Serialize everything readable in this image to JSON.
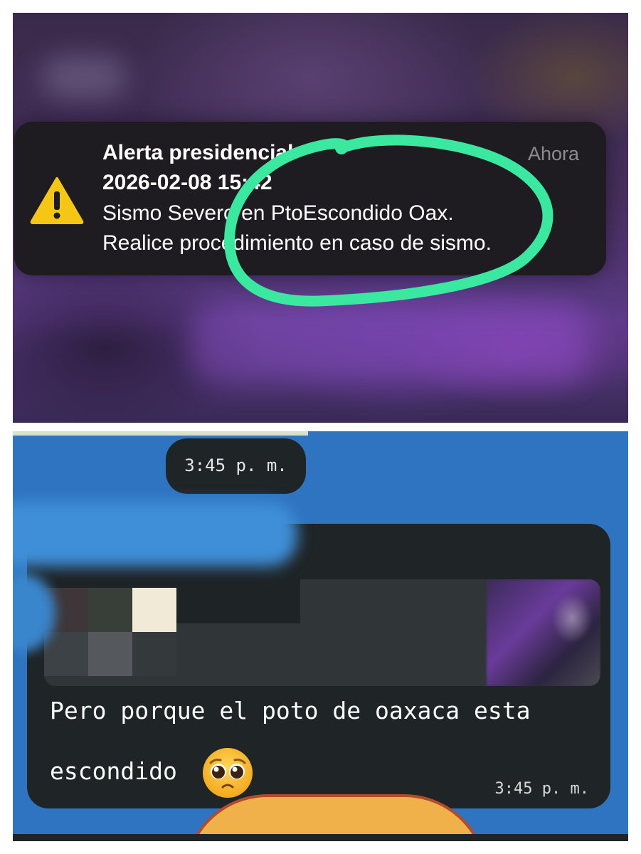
{
  "notification": {
    "title": "Alerta presidencial",
    "datetime": "2026-02-08 15:42",
    "line1": "Sismo Severo en PtoEscondido Oax.",
    "line2": "Realice procedimiento en caso de sismo.",
    "time": "Ahora",
    "icon": "warning-triangle-icon",
    "highlight_color": "#3be8a0"
  },
  "chat": {
    "date_chip": "3:45 p. m.",
    "message": {
      "line1": "Pero porque el poto de oaxaca esta",
      "line2": "escondido",
      "emoji": "pleading-face-emoji",
      "time": "3:45 p. m."
    },
    "background_color": "#2f74c0"
  }
}
